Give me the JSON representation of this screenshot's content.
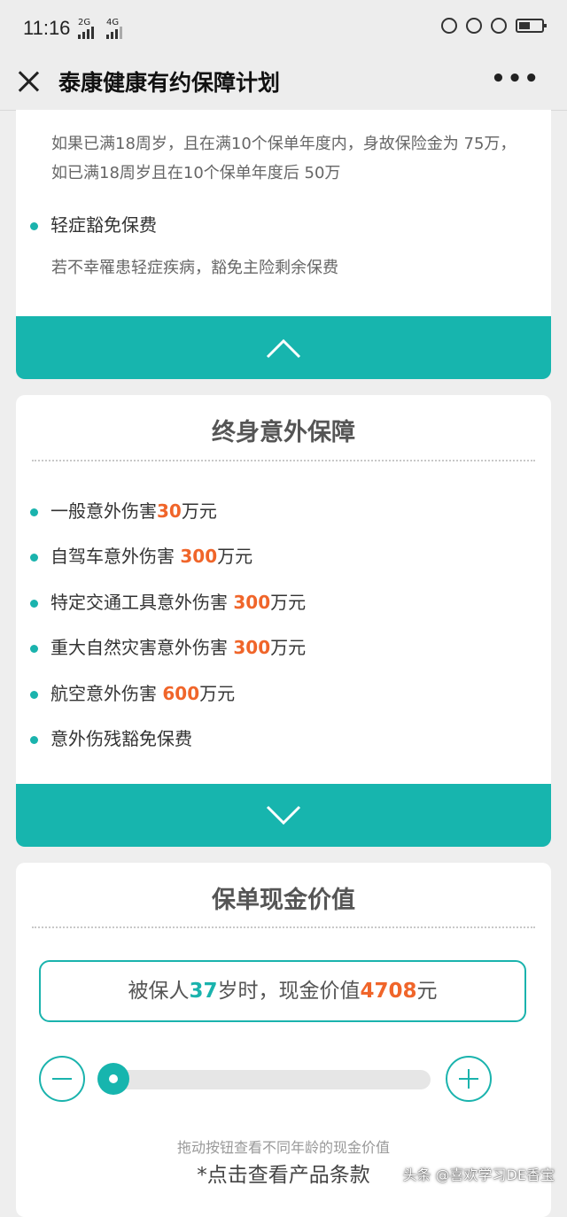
{
  "status_bar": {
    "time": "11:16",
    "signal_1": "2G",
    "signal_2": "4G",
    "icons": [
      "mute-icon",
      "lock-icon",
      "alarm-icon",
      "battery-icon"
    ]
  },
  "nav": {
    "title": "泰康健康有约保障计划",
    "more": "•••"
  },
  "card1": {
    "paragraph": "如果已满18周岁，且在满10个保单年度内，身故保险金为 75万，如已满18周岁且在10个保单年度后 50万",
    "bullet": "轻症豁免保费",
    "bullet_desc": "若不幸罹患轻症疾病，豁免主险剩余保费"
  },
  "accident": {
    "title": "终身意外保障",
    "items": [
      {
        "pre": "一般意外伤害",
        "amount": "30",
        "post": "万元"
      },
      {
        "pre": "自驾车意外伤害 ",
        "amount": "300",
        "post": "万元"
      },
      {
        "pre": "特定交通工具意外伤害 ",
        "amount": "300",
        "post": "万元"
      },
      {
        "pre": "重大自然灾害意外伤害 ",
        "amount": "300",
        "post": "万元"
      },
      {
        "pre": "航空意外伤害 ",
        "amount": "600",
        "post": "万元"
      },
      {
        "pre": "意外伤残豁免保费",
        "amount": "",
        "post": ""
      }
    ]
  },
  "cash_value": {
    "title": "保单现金价值",
    "prefix": "被保人",
    "age": "37",
    "middle": "岁时，现金价值",
    "value": "4708",
    "suffix": "元",
    "slider_level": 0.0,
    "hint": "拖动按钮查看不同年龄的现金价值",
    "terms": "*点击查看产品条款"
  },
  "watermark": "头条 @喜欢学习DE香宝",
  "colors": {
    "teal": "#17b5ae",
    "orange": "#f0652a"
  }
}
